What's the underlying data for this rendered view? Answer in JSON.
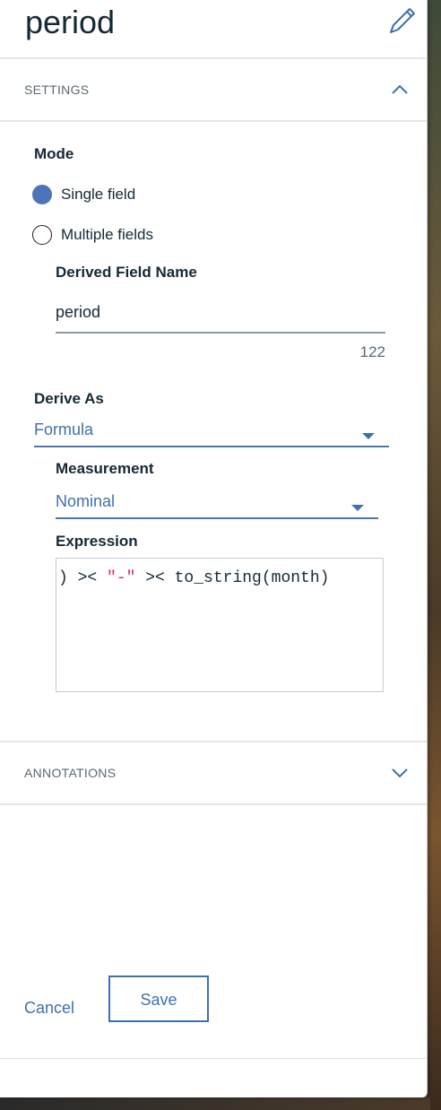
{
  "header": {
    "title": "period",
    "edit_icon": "pencil-icon"
  },
  "settings": {
    "section_label": "SETTINGS",
    "collapse_icon": "chevron-up-icon",
    "mode": {
      "label": "Mode",
      "options": [
        {
          "label": "Single field",
          "selected": true
        },
        {
          "label": "Multiple fields",
          "selected": false
        }
      ]
    },
    "derived_field_name": {
      "label": "Derived Field Name",
      "value": "period",
      "counter": "122"
    },
    "derive_as": {
      "label": "Derive As",
      "value": "Formula"
    },
    "measurement": {
      "label": "Measurement",
      "value": "Nominal"
    },
    "expression": {
      "label": "Expression",
      "parts": [
        ") >< ",
        "\"-\"",
        " >< to_string(month)"
      ]
    }
  },
  "annotations": {
    "section_label": "ANNOTATIONS",
    "expand_icon": "chevron-down-icon"
  },
  "footer": {
    "cancel_label": "Cancel",
    "save_label": "Save"
  },
  "colors": {
    "accent": "#3d70b2",
    "radio_selected": "#4d74b8",
    "string_literal": "#d12765"
  }
}
